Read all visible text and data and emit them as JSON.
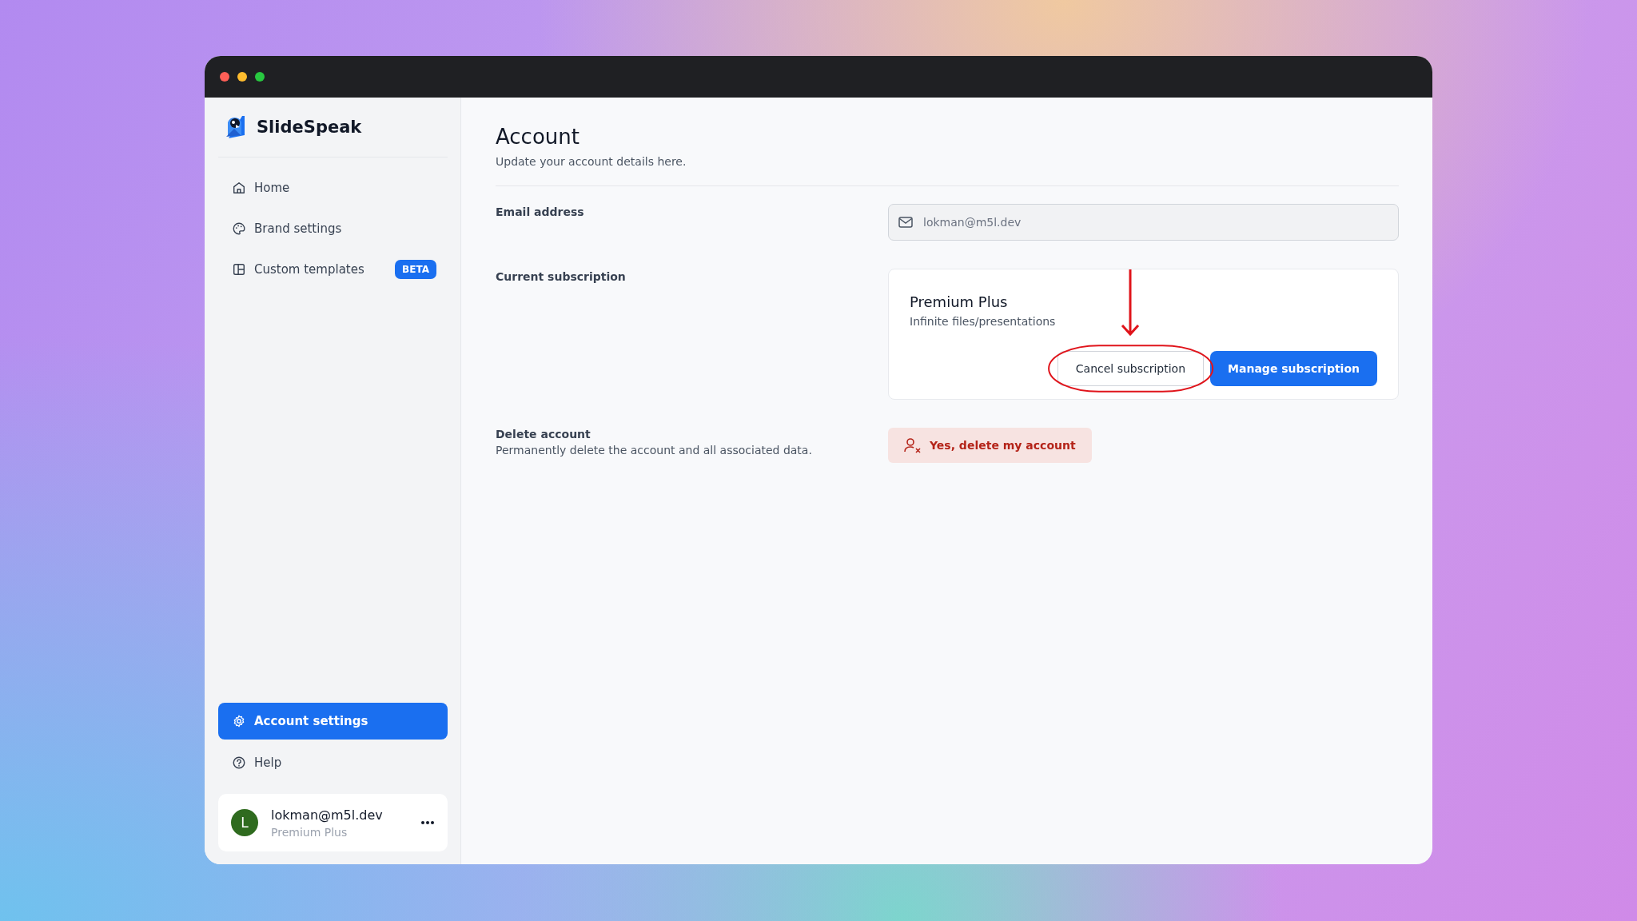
{
  "app": {
    "name": "SlideSpeak"
  },
  "sidebar": {
    "items": [
      {
        "label": "Home",
        "kind": "home",
        "selected": false
      },
      {
        "label": "Brand settings",
        "kind": "palette",
        "selected": false
      },
      {
        "label": "Custom templates",
        "kind": "layout",
        "selected": false,
        "badge": "BETA"
      }
    ],
    "bottom_items": [
      {
        "label": "Account settings",
        "kind": "gear",
        "selected": true
      },
      {
        "label": "Help",
        "kind": "help",
        "selected": false
      }
    ],
    "user": {
      "avatar_letter": "L",
      "email": "lokman@m5l.dev",
      "plan": "Premium Plus"
    }
  },
  "page": {
    "title": "Account",
    "subtitle": "Update your account details here."
  },
  "email": {
    "label": "Email address",
    "value": "lokman@m5l.dev"
  },
  "subscription": {
    "label": "Current subscription",
    "plan": "Premium Plus",
    "description": "Infinite files/presentations",
    "buttons": [
      {
        "label": "Cancel subscription",
        "kind": "secondary",
        "highlighted": true
      },
      {
        "label": "Manage subscription",
        "kind": "primary",
        "highlighted": false
      }
    ]
  },
  "delete": {
    "label": "Delete account",
    "description": "Permanently delete the account and all associated data.",
    "button": "Yes, delete my account"
  }
}
